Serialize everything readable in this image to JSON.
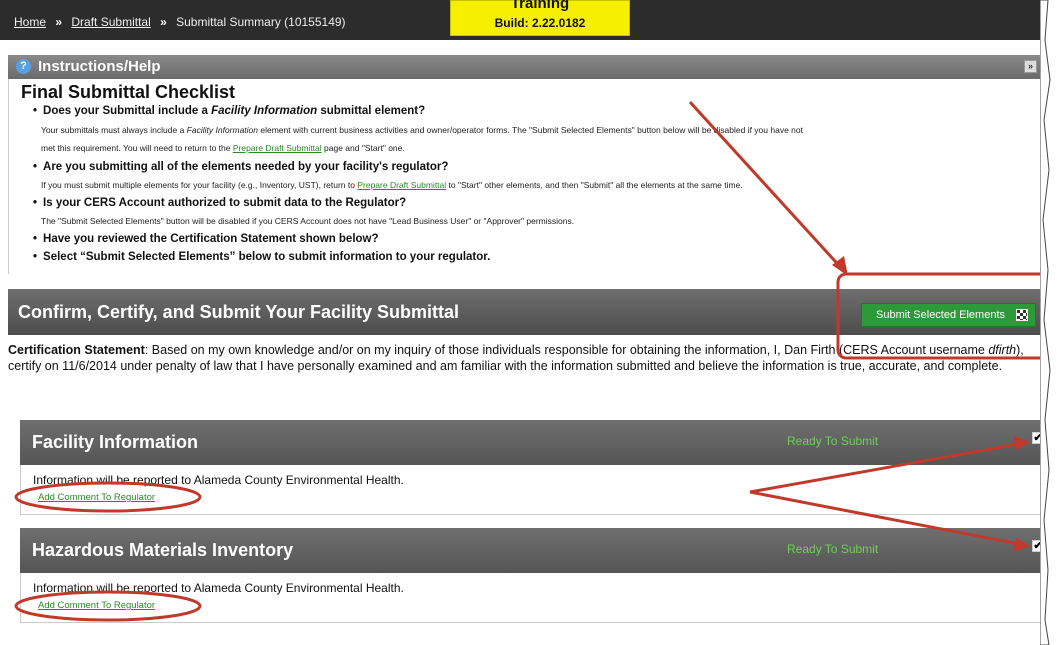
{
  "breadcrumb": {
    "home": "Home",
    "sep": "»",
    "draft": "Draft Submittal",
    "current": "Submittal Summary (10155149)"
  },
  "build_box": {
    "environment": "Training",
    "build": "Build: 2.22.0182"
  },
  "instructions": {
    "header": "Instructions/Help",
    "help_icon": "?",
    "collapse_icon": "»",
    "checklist_title": "Final Submittal Checklist",
    "items": [
      {
        "question_pre": "Does your Submittal include a ",
        "question_em": "Facility Information",
        "question_post": " submittal element?",
        "line1_pre": "Your submittals must always include a ",
        "line1_em": "Facility Information",
        "line1_post": " element with current business activities and owner/operator forms. The \"Submit Selected Elements\" button below will be disabled if you have not",
        "line2_pre": "met this requirement. You will need to return to the ",
        "line2_link": "Prepare Draft Submittal",
        "line2_post": " page and \"Start\" one."
      },
      {
        "question": "Are you submitting all of the elements needed by your facility's regulator?",
        "line1_pre": "If you must submit multiple elements for your facility (e.g., Inventory, UST), return to ",
        "line1_link": "Prepare Draft Submittal",
        "line1_post": " to \"Start\" other elements, and then \"Submit\" all the elements at the same time."
      },
      {
        "question": "Is your CERS Account authorized to submit data to the Regulator?",
        "line1": "The \"Submit Selected Elements\" button will be disabled if you CERS Account does not have \"Lead Business User\" or \"Approver\" permissions."
      },
      {
        "question": "Have you reviewed the Certification Statement shown below?"
      },
      {
        "question": "Select “Submit Selected Elements” below to submit information to your regulator."
      }
    ]
  },
  "confirm": {
    "title": "Confirm, Certify, and Submit Your Facility Submittal",
    "submit_label": "Submit Selected Elements",
    "submit_icon": "checkered-flag-icon"
  },
  "certification": {
    "label": "Certification Statement",
    "text_pre": ": Based on my own knowledge and/or on my inquiry of those individuals responsible for obtaining the information, I, Dan Firth (CERS Account username ",
    "username": "dfirth",
    "text_post": "), certify on 11/6/2014 under penalty of law that I have personally examined and am familiar with the information submitted and believe the information is true, accurate, and complete."
  },
  "elements": [
    {
      "title": "Facility Information",
      "status": "Ready To Submit",
      "checked": "✔",
      "info": "Information will be reported to Alameda County Environmental Health.",
      "comment_link": "Add Comment To Regulator"
    },
    {
      "title": "Hazardous Materials Inventory",
      "status": "Ready To Submit",
      "checked": "✔",
      "info": "Information will be reported to Alameda County Environmental Health.",
      "comment_link": "Add Comment To Regulator"
    }
  ],
  "colors": {
    "annotation_red": "#c0392b",
    "submit_green": "#2d9a3a",
    "status_green": "#6fcf58",
    "build_yellow": "#f6f000"
  }
}
